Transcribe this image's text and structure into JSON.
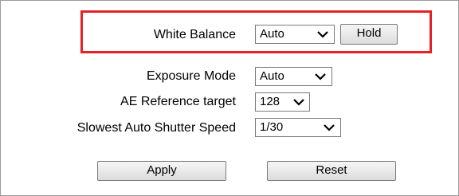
{
  "settings": {
    "white_balance": {
      "label": "White Balance",
      "value": "Auto",
      "hold_label": "Hold"
    },
    "exposure_mode": {
      "label": "Exposure Mode",
      "value": "Auto"
    },
    "ae_reference_target": {
      "label": "AE Reference target",
      "value": "128"
    },
    "slowest_auto_shutter_speed": {
      "label": "Slowest Auto Shutter Speed",
      "value": "1/30"
    }
  },
  "actions": {
    "apply_label": "Apply",
    "reset_label": "Reset"
  },
  "colors": {
    "highlight_border": "#e32227"
  }
}
